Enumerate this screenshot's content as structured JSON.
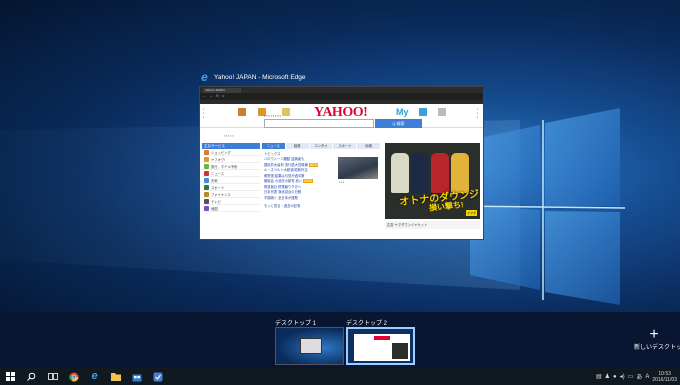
{
  "window": {
    "title": "Yahoo! JAPAN - Microsoft Edge",
    "browser": {
      "tab_label": "Yahoo! JAPAN"
    },
    "page": {
      "logo": "YAHOO!",
      "logo_sub": "JAPAN",
      "my_label": "My",
      "search_button": "Q 検索",
      "topics_title": "トピックス",
      "topics_tabs": [
        "ニュース",
        "経済",
        "エンタメ",
        "スポーツ",
        "地域"
      ],
      "sidebar_head": "主なサービス",
      "sidebar_items": [
        "ショッピング",
        "ヤフオク!",
        "旅行、ホテル予約",
        "ニュース",
        "天気",
        "スポーツ",
        "ファイナンス",
        "テレビ",
        "地図"
      ],
      "topics": [
        "ハロウィーン騒動 逮捕者も",
        "国民的大喜利 流行語大賞候補",
        "ルーズベルト大統領 昭和外交",
        "衆院選 結果は与党が過半数",
        "都議会 小池氏の新党 勢い",
        "鉄道各社 終電繰り下げへ",
        "日本代表 強化試合の日程",
        "不調続く 全日本が連敗"
      ],
      "new_badge": "NEW",
      "more_link": "もっと見る・過去の記事",
      "ad_line1": "オトナのダウンジャケット",
      "ad_line2": "損い撃ち!",
      "ad_badge": "ヤマダ",
      "ad_foot": "広告 ヤマダウンジャケット"
    }
  },
  "desktops": {
    "items": [
      {
        "label": "デスクトップ 1",
        "selected": false
      },
      {
        "label": "デスクトップ 2",
        "selected": true
      }
    ],
    "new_desktop_label": "新しいデスクトップ"
  },
  "taskbar": {
    "icons": [
      "windows-start-icon",
      "search-icon",
      "task-view-icon",
      "chrome-icon",
      "edge-icon",
      "file-explorer-icon",
      "store-icon",
      "app-icon"
    ],
    "ime_indicator": "A",
    "time": "10:53",
    "date": "2016/11/03"
  },
  "colors": {
    "accent": "#3d7fd6",
    "yahoo_red": "#e60033",
    "taskbar": "#101820"
  }
}
